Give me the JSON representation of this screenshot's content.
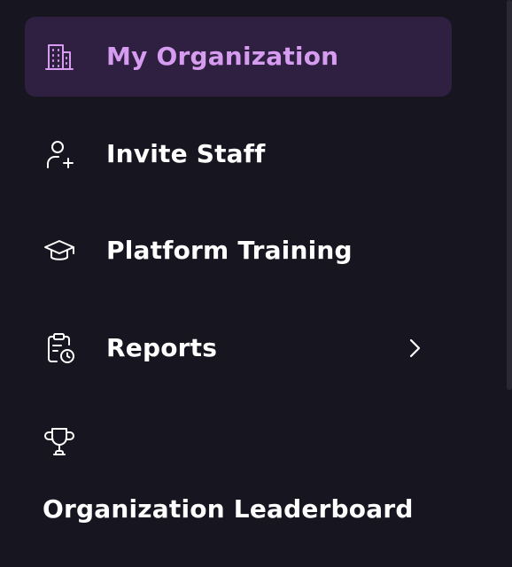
{
  "colors": {
    "background": "#17151f",
    "active_background": "#2f1f40",
    "active_text": "#d59cf0",
    "text": "#ffffff"
  },
  "nav": {
    "items": [
      {
        "label": "My Organization",
        "icon": "building-icon",
        "active": true
      },
      {
        "label": "Invite Staff",
        "icon": "add-user-icon",
        "active": false
      },
      {
        "label": "Platform Training",
        "icon": "graduation-cap-icon",
        "active": false
      },
      {
        "label": "Reports",
        "icon": "clipboard-clock-icon",
        "active": false,
        "expandable": true,
        "chevron_icon": "chevron-right-icon"
      },
      {
        "label": "Organization Leaderboard",
        "icon": "trophy-icon",
        "active": false
      }
    ]
  }
}
